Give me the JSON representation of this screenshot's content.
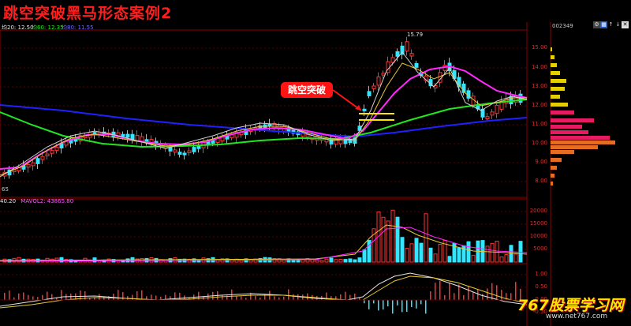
{
  "title": "跳空突破黑马形态案例2",
  "indicators": {
    "ma20": "均20: 12.50",
    "ma60": "均60: 12.35",
    "ma80": "均80: 11.55"
  },
  "stock_code": "002349",
  "callout": "跳空突破",
  "peak_label": "15.79",
  "low_label": "65",
  "volume_header": {
    "vol": "40.20",
    "mavol": "MAVOL2: 43865.80"
  },
  "price_axis": [
    "15.00",
    "14.00",
    "13.00",
    "12.00",
    "11.00",
    "10.00",
    "9.00",
    "8.00"
  ],
  "volume_axis": [
    "20000",
    "15000",
    "10000",
    "5000"
  ],
  "macd_axis": [
    "1.00",
    "0.50",
    "0.00",
    "-0.50"
  ],
  "watermark": {
    "brand": "767股票学习网",
    "url": "www.net767.com"
  },
  "colors": {
    "title": "#ff1e1e",
    "up": "#ff3232",
    "down": "#32e6ff",
    "ma_blue": "#2020ff",
    "ma_green": "#20e620",
    "ma_magenta": "#ff28ff",
    "ma_yellow": "#e6c832",
    "callout_bg": "#ff1414",
    "grid": "#8b0000"
  },
  "toolbar_icons": [
    "gear-icon",
    "grid-icon",
    "up-arrow-icon",
    "down-arrow-icon",
    "close-icon"
  ]
}
